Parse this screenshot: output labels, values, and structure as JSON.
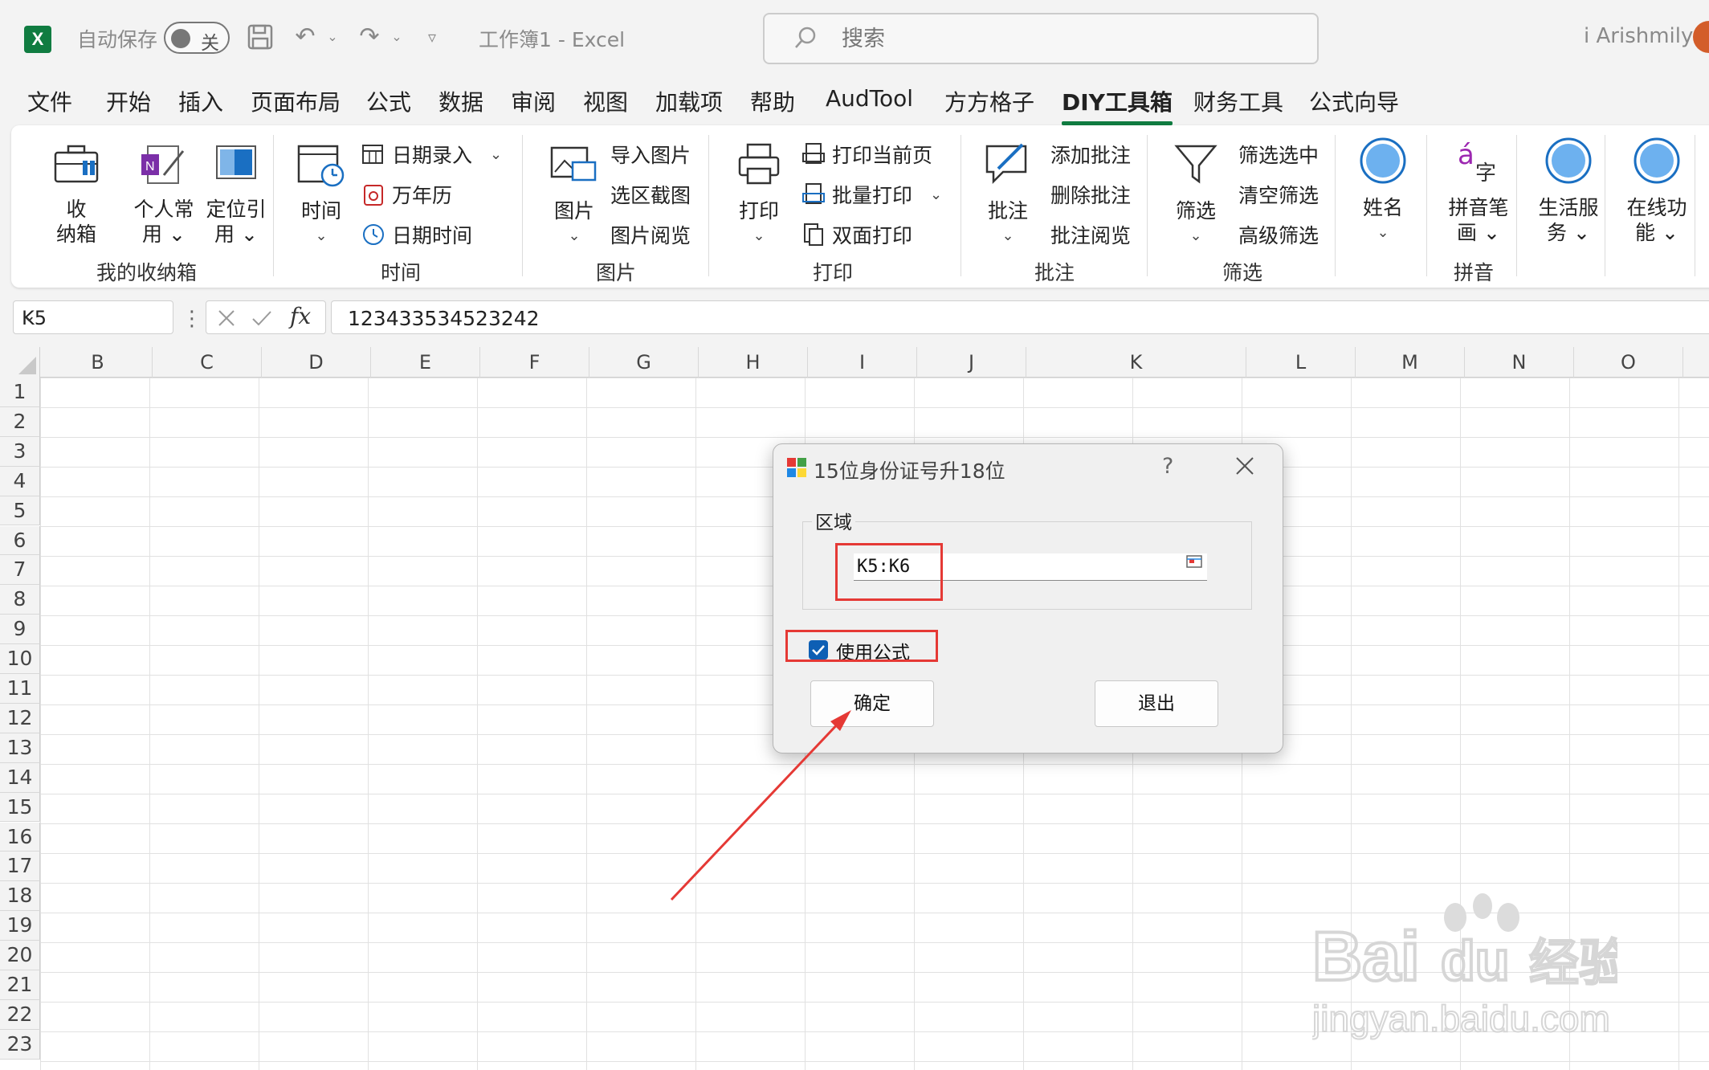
{
  "titlebar": {
    "autosave_label": "自动保存",
    "autosave_state": "关",
    "workbook_title": "工作簿1  -  Excel",
    "search_placeholder": "搜索",
    "user_name": "i Arishmily"
  },
  "menu": {
    "tabs": [
      "文件",
      "开始",
      "插入",
      "页面布局",
      "公式",
      "数据",
      "审阅",
      "视图",
      "加载项",
      "帮助",
      "AudTool",
      "方方格子",
      "DIY工具箱",
      "财务工具",
      "公式向导"
    ],
    "active": "DIY工具箱"
  },
  "ribbon": {
    "g1": {
      "label": "我的收纳箱",
      "b1": "收\n纳箱",
      "b2": "个人常\n用 ⌄",
      "b3": "定位引\n用 ⌄"
    },
    "g2": {
      "label": "时间",
      "big": "时间",
      "s1": "日期录入",
      "s2": "万年历",
      "s3": "日期时间"
    },
    "g3": {
      "label": "图片",
      "big": "图片",
      "s1": "导入图片",
      "s2": "选区截图",
      "s3": "图片阅览"
    },
    "g4": {
      "label": "打印",
      "big": "打印",
      "s1": "打印当前页",
      "s2": "批量打印",
      "s3": "双面打印"
    },
    "g5": {
      "label": "批注",
      "big": "批注",
      "s1": "添加批注",
      "s2": "删除批注",
      "s3": "批注阅览"
    },
    "g6": {
      "label": "筛选",
      "big": "筛选",
      "s1": "筛选选中",
      "s2": "清空筛选",
      "s3": "高级筛选"
    },
    "g7": {
      "big": "姓名"
    },
    "g8": {
      "label": "拼音",
      "big": "拼音笔\n画 ⌄"
    },
    "g9": {
      "big": "生活服\n务 ⌄"
    },
    "g10": {
      "big": "在线功\n能 ⌄"
    }
  },
  "formula_bar": {
    "name_box": "K5",
    "formula": "123433534523242"
  },
  "grid": {
    "columns": [
      "B",
      "C",
      "D",
      "E",
      "F",
      "G",
      "H",
      "I",
      "J",
      "K",
      "L",
      "M",
      "N",
      "O"
    ],
    "rows": [
      "1",
      "2",
      "3",
      "4",
      "5",
      "6",
      "7",
      "8",
      "9",
      "10",
      "11",
      "12",
      "13",
      "14",
      "15",
      "16",
      "17",
      "18",
      "19",
      "20",
      "21",
      "22",
      "23"
    ]
  },
  "dialog": {
    "title": "15位身份证号升18位",
    "help": "?",
    "group_label": "区域",
    "range_value": "K5:K6",
    "checkbox_label": "使用公式",
    "checkbox_checked": true,
    "ok_label": "确定",
    "exit_label": "退出"
  },
  "colors": {
    "excel_green": "#107c41",
    "annotation_red": "#e53935",
    "checkbox_blue": "#0e5fb4"
  }
}
